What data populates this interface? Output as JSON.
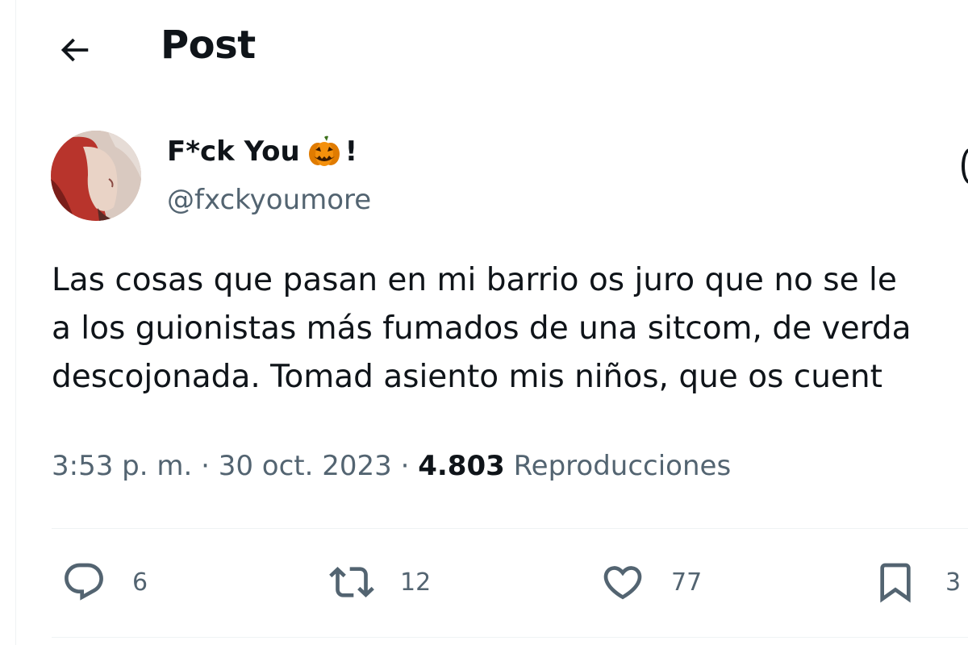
{
  "header": {
    "title": "Post",
    "back_icon": "arrow-left-icon"
  },
  "author": {
    "display_name": "F*ck You",
    "name_emoji": "pumpkin-icon",
    "name_suffix": "!",
    "handle": "@fxckyoumore",
    "avatar_colors": [
      "#b8342c",
      "#d8c7bd"
    ]
  },
  "tweet": {
    "lines": [
      "Las cosas que pasan en mi barrio os juro que no se le",
      "a los guionistas más fumados de una sitcom, de verda",
      "descojonada. Tomad asiento mis niños, que os cuent"
    ]
  },
  "meta": {
    "time": "3:53 p. m.",
    "separator": " · ",
    "date": "30 oct. 2023",
    "views_count": "4.803",
    "views_label": "Reproducciones"
  },
  "actions": {
    "reply": {
      "icon": "reply-icon",
      "count": "6"
    },
    "retweet": {
      "icon": "retweet-icon",
      "count": "12"
    },
    "like": {
      "icon": "heart-icon",
      "count": "77"
    },
    "bookmark": {
      "icon": "bookmark-icon",
      "count": "3"
    }
  },
  "colors": {
    "text_primary": "#0f1419",
    "text_secondary": "#536471",
    "divider": "#eff3f4",
    "pumpkin": "#f4900c"
  }
}
